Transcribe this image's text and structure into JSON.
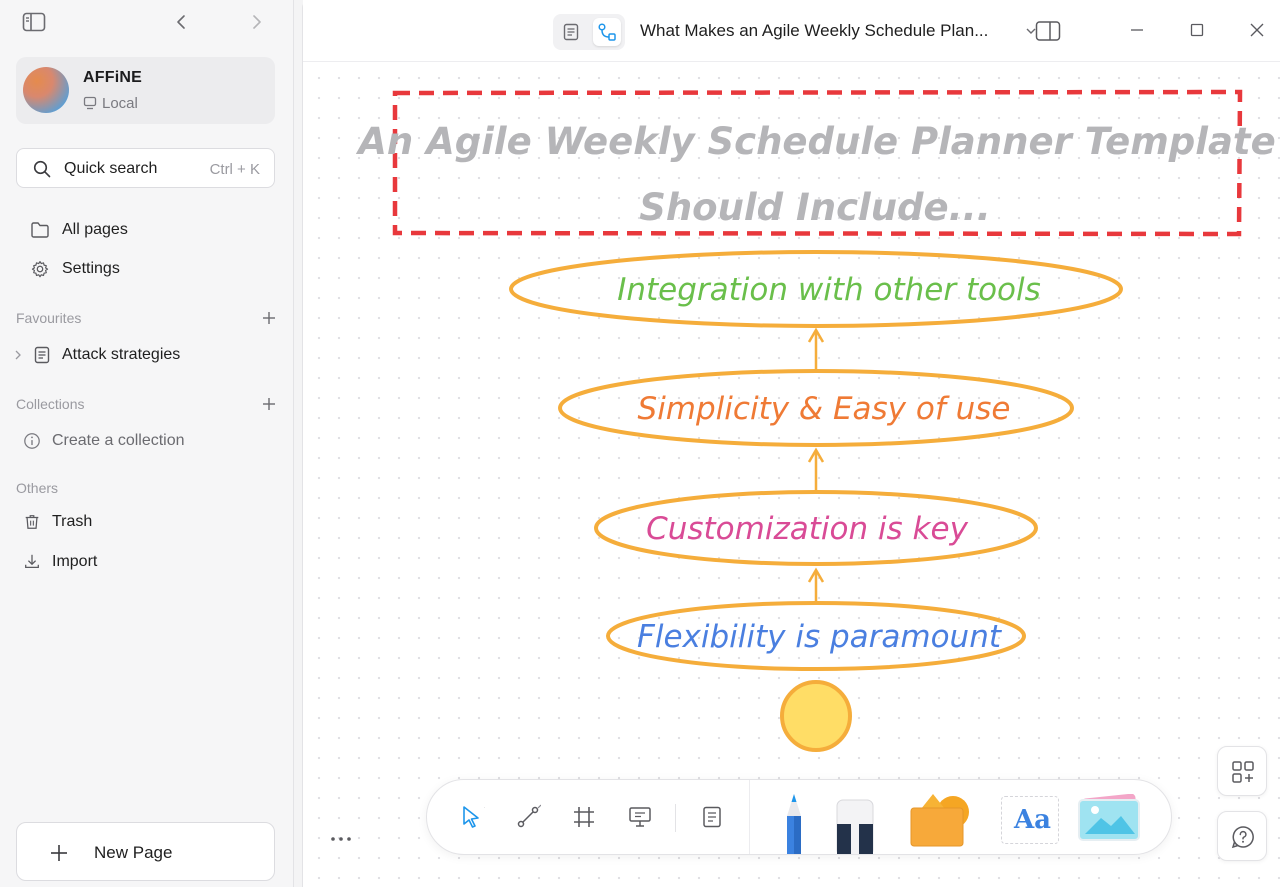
{
  "sidebar": {
    "workspace": {
      "name": "AFFiNE",
      "location": "Local"
    },
    "search": {
      "label": "Quick search",
      "shortcut": "Ctrl + K"
    },
    "nav": {
      "all_pages": "All pages",
      "settings": "Settings"
    },
    "favourites": {
      "title": "Favourites",
      "items": [
        {
          "label": "Attack strategies"
        }
      ]
    },
    "collections": {
      "title": "Collections",
      "create": "Create a collection"
    },
    "others": {
      "title": "Others",
      "trash": "Trash",
      "import": "Import"
    },
    "new_page": "New Page"
  },
  "header": {
    "title": "What Makes an Agile Weekly Schedule Plan..."
  },
  "canvas": {
    "heading_line1": "An Agile Weekly Schedule Planner Template",
    "heading_line2": "Should Include...",
    "items": [
      {
        "label": "Integration with other tools",
        "color": "#6abf4b"
      },
      {
        "label": "Simplicity & Easy of use",
        "color": "#ef7a35"
      },
      {
        "label": "Customization is key",
        "color": "#d94b96"
      },
      {
        "label": "Flexibility is paramount",
        "color": "#4a7fe0"
      }
    ],
    "colors": {
      "ellipse_stroke": "#f5ad3b",
      "frame_stroke": "#e8383c",
      "circle_fill": "#ffdd66",
      "heading": "#b5b5b8"
    }
  },
  "toolbar": {
    "tools": [
      "select-icon",
      "connector-icon",
      "frame-icon",
      "presentation-icon",
      "note-icon",
      "pen-icon",
      "eraser-icon",
      "shape-icon",
      "text-icon",
      "image-icon"
    ],
    "text_tool_label": "Aa"
  },
  "colors": {
    "accent": "#1e96eb"
  }
}
